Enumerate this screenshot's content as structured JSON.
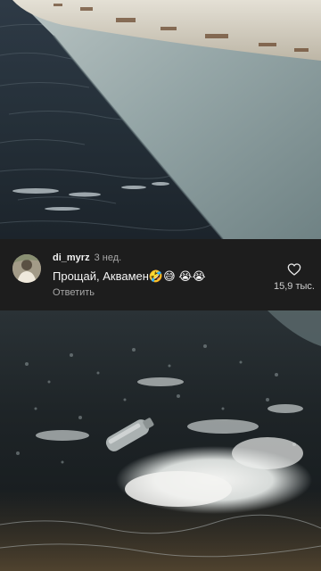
{
  "comment": {
    "username": "di_myrz",
    "time_ago": "3 нед.",
    "text": "Прощай, Аквамен🤣😅 😭😭",
    "reply_label": "Ответить",
    "like_count": "15,9 тыс."
  },
  "icons": {
    "like": "heart-outline-icon"
  },
  "colors": {
    "overlay_background": "#1d1d1d",
    "primary_text": "#f5f5f5",
    "secondary_text": "#a8a8a8"
  }
}
